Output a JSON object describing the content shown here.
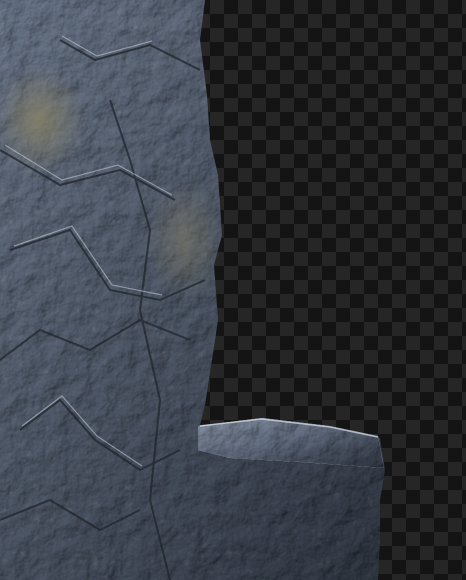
{
  "image": {
    "subject": "rock-cliff-cutout",
    "background": "transparency-checkerboard",
    "colors": {
      "rock_light": "#9aa3b0",
      "rock_mid": "#5f6672",
      "rock_dark": "#2c3038",
      "rock_warm": "#7a7660",
      "checker_dark": "#141414",
      "checker_light": "#262626"
    }
  }
}
